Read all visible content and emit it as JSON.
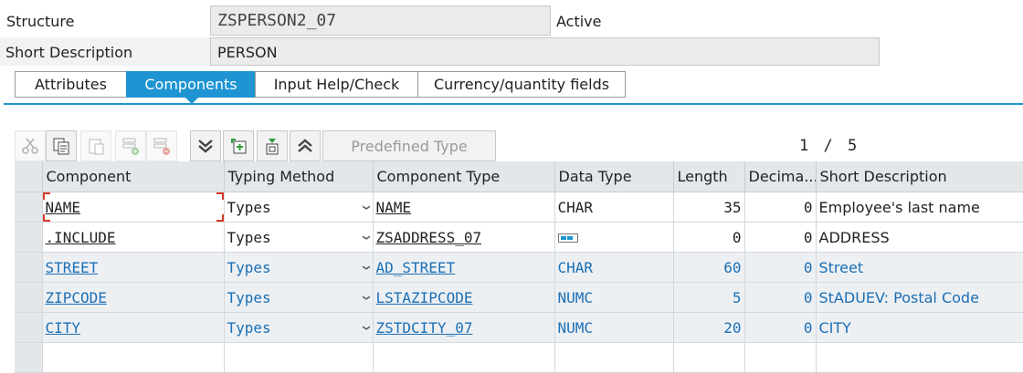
{
  "header": {
    "structure_label": "Structure",
    "structure_value": "ZSPERSON2_07",
    "status": "Active",
    "short_desc_label": "Short Description",
    "short_desc_value": "PERSON"
  },
  "tabs": [
    {
      "label": "Attributes",
      "active": false
    },
    {
      "label": "Components",
      "active": true
    },
    {
      "label": "Input Help/Check",
      "active": false
    },
    {
      "label": "Currency/quantity fields",
      "active": false
    }
  ],
  "toolbar": {
    "predefined_type_label": "Predefined Type",
    "page_current": "1",
    "page_sep": "/",
    "page_total": "5",
    "icons": [
      "cut-icon",
      "copy-icon",
      "paste-icon",
      "insert-row-icon",
      "delete-row-icon",
      "collapse-icon",
      "new-element-icon",
      "show-element-icon",
      "expand-icon"
    ]
  },
  "table": {
    "headers": [
      "Component",
      "Typing Method",
      "Component Type",
      "Data Type",
      "Length",
      "Decima...",
      "Short Description"
    ],
    "rows": [
      {
        "component": "NAME",
        "typing": "Types",
        "comptype": "NAME",
        "datatype": "CHAR",
        "length": "35",
        "decimals": "0",
        "desc": "Employee's last name",
        "disabled": false
      },
      {
        "component": ".INCLUDE",
        "typing": "Types",
        "comptype": "ZSADDRESS_07",
        "datatype": "",
        "length": "0",
        "decimals": "0",
        "desc": "ADDRESS",
        "disabled": false
      },
      {
        "component": "STREET",
        "typing": "Types",
        "comptype": "AD_STREET",
        "datatype": "CHAR",
        "length": "60",
        "decimals": "0",
        "desc": "Street",
        "disabled": true
      },
      {
        "component": "ZIPCODE",
        "typing": "Types",
        "comptype": "LSTAZIPCODE",
        "datatype": "NUMC",
        "length": "5",
        "decimals": "0",
        "desc": "StADUEV: Postal Code",
        "disabled": true
      },
      {
        "component": "CITY",
        "typing": "Types",
        "comptype": "ZSTDCITY_07",
        "datatype": "NUMC",
        "length": "20",
        "decimals": "0",
        "desc": "CITY",
        "disabled": true
      },
      {
        "component": "",
        "typing": "",
        "comptype": "",
        "datatype": "",
        "length": "",
        "decimals": "",
        "desc": "",
        "disabled": false
      }
    ]
  },
  "colors": {
    "accent": "#1e94d2",
    "link_disabled": "#1b6fb5",
    "header_bg": "#e4e7ea"
  }
}
